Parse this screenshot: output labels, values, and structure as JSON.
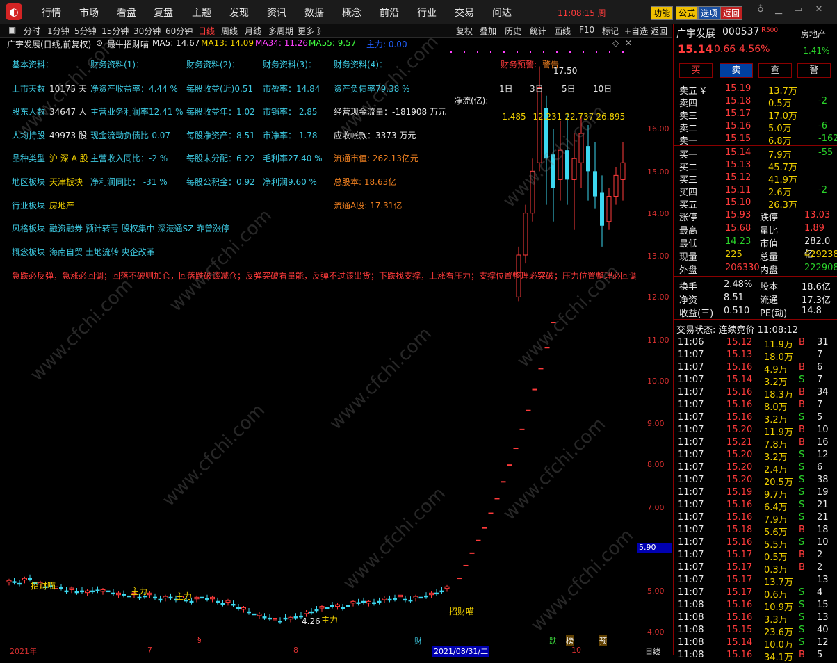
{
  "menu": [
    "行情",
    "市场",
    "看盘",
    "复盘",
    "主题",
    "发现",
    "资讯",
    "数据",
    "概念",
    "前沿",
    "行业",
    "交易",
    "问达"
  ],
  "clock": "11:08:15 周一",
  "top_buttons": [
    "功能",
    "公式",
    "选项",
    "返回"
  ],
  "periods": [
    "分时",
    "1分钟",
    "5分钟",
    "15分钟",
    "30分钟",
    "60分钟",
    "日线",
    "周线",
    "月线",
    "多周期",
    "更多 》"
  ],
  "tools": [
    "复权",
    "叠加",
    "历史",
    "统计",
    "画线",
    "F10",
    "标记",
    "+自选",
    "返回"
  ],
  "chart_title": "广宇发展(日线,前复权)",
  "indicator_name": "最牛招财喵",
  "ma": {
    "ma5": "MA5: 14.67",
    "ma13": "MA13: 14.09",
    "ma34": "MA34: 11.26",
    "ma55": "MA55: 9.57",
    "main": "主力: 0.00"
  },
  "fund_headers": [
    "基本资料：",
    "财务资料(1)：",
    "财务资料(2)：",
    "财务资料(3)：",
    "财务资料(4)：",
    "财务预警:",
    "警告"
  ],
  "fund": {
    "r1": [
      "上市天数",
      "10175 天",
      "净资产收益率：4.44 %",
      "每股收益(近)0.51",
      "市盈率：14.84",
      "资产负债率79.38 %"
    ],
    "r2": [
      "股东人数",
      "34647 人",
      "主营业务利润率12.41 %",
      "每股收益年：1.02",
      "市销率： 2.85",
      "经营现金流量：-181908 万元"
    ],
    "r3": [
      "人均持股",
      "49973 股",
      "现金流动负债比-0.07",
      "每股净资产：8.51",
      "市净率： 1.78",
      "应收帐款：3373 万元"
    ],
    "r4": [
      "品种类型",
      "沪 深 A 股",
      "主营收入同比：-2 %",
      "每股未分配：6.22",
      "毛利率27.40 %",
      "流通市值: 262.13亿元"
    ],
    "r5": [
      "地区板块",
      "天津板块",
      "净利润同比： -31 %",
      "每股公积金：0.92",
      "净利润9.60 %",
      "总股本: 18.63亿"
    ],
    "r6": [
      "行业板块",
      "房地产",
      "流通A股: 17.31亿"
    ],
    "r7": [
      "风格板块",
      "融资融券 预计转亏 股权集中 深港通SZ 昨曾涨停"
    ],
    "r8": [
      "概念板块",
      "海南自贸 土地流转 央企改革"
    ],
    "warning": "急跌必反弹，急涨必回调；回落不破则加仓，回落跌破该减仓；反弹突破看量能，反弹不过该出货；下跌找支撑，上涨看压力；支撑位置整理必突破；压力位置整理必回调"
  },
  "netflow": {
    "label": "净流(亿):",
    "days": [
      "1日",
      "3日",
      "5日",
      "10日"
    ],
    "values": [
      "-1.485",
      "-12.231",
      "-22.737",
      "-26.895"
    ]
  },
  "annotations": {
    "high": "17.50",
    "low": "4.26",
    "zhaocaimiao": "招财喵",
    "zhuli": "主力"
  },
  "yaxis_ticks": [
    "16.00",
    "15.00",
    "14.00",
    "13.00",
    "12.00",
    "11.00",
    "10.00",
    "9.00",
    "8.00",
    "7.00",
    "6.00",
    "5.00",
    "4.00"
  ],
  "price_box": "5.90",
  "xaxis": [
    "2021年",
    "7",
    "8",
    "2021/08/31/二",
    "10",
    "日线"
  ],
  "bottom_marks": [
    "财",
    "跌",
    "榜",
    "预"
  ],
  "right": {
    "name": "广宇发展",
    "code": "000537",
    "sector": "房地产",
    "price": "15.14",
    "change": "0.66",
    "pct": "4.56%",
    "sector_pct": "-1.41%",
    "buttons": [
      "买",
      "卖",
      "查",
      "警"
    ],
    "asks": [
      {
        "label": "卖五 ¥",
        "price": "15.19",
        "vol": "13.7万",
        "chg": ""
      },
      {
        "label": "卖四",
        "price": "15.18",
        "vol": "0.5万",
        "chg": "-2"
      },
      {
        "label": "卖三",
        "price": "15.17",
        "vol": "17.0万",
        "chg": ""
      },
      {
        "label": "卖二",
        "price": "15.16",
        "vol": "5.0万",
        "chg": "-6"
      },
      {
        "label": "卖一",
        "price": "15.15",
        "vol": "6.8万",
        "chg": "-162"
      }
    ],
    "bids": [
      {
        "label": "买一",
        "price": "15.14",
        "vol": "7.9万",
        "chg": "-55"
      },
      {
        "label": "买二",
        "price": "15.13",
        "vol": "45.7万",
        "chg": ""
      },
      {
        "label": "买三",
        "price": "15.12",
        "vol": "41.9万",
        "chg": ""
      },
      {
        "label": "买四",
        "price": "15.11",
        "vol": "2.6万",
        "chg": "-2"
      },
      {
        "label": "买五",
        "price": "15.10",
        "vol": "26.3万",
        "chg": ""
      }
    ],
    "stats": [
      [
        "涨停",
        "15.93",
        "跌停",
        "13.03"
      ],
      [
        "最高",
        "15.68",
        "量比",
        "1.89"
      ],
      [
        "最低",
        "14.23",
        "市值",
        "282.0亿"
      ],
      [
        "现量",
        "225",
        "总量",
        "429238"
      ],
      [
        "外盘",
        "206330",
        "内盘",
        "222908"
      ]
    ],
    "stats2": [
      [
        "换手",
        "2.48%",
        "股本",
        "18.6亿"
      ],
      [
        "净资",
        "8.51",
        "流通",
        "17.3亿"
      ],
      [
        "收益(三)",
        "0.510",
        "PE(动)",
        "14.8"
      ]
    ],
    "trade_status": "交易状态: 连续竞价 11:08:12",
    "ticks": [
      [
        "11:06",
        "15.12",
        "11.9万",
        "B",
        "31"
      ],
      [
        "11:07",
        "15.13",
        "18.0万",
        "",
        "7"
      ],
      [
        "11:07",
        "15.16",
        "4.9万",
        "B",
        "6"
      ],
      [
        "11:07",
        "15.14",
        "3.2万",
        "S",
        "7"
      ],
      [
        "11:07",
        "15.16",
        "18.3万",
        "B",
        "34"
      ],
      [
        "11:07",
        "15.16",
        "8.0万",
        "B",
        "7"
      ],
      [
        "11:07",
        "15.16",
        "3.2万",
        "S",
        "5"
      ],
      [
        "11:07",
        "15.20",
        "11.9万",
        "B",
        "10"
      ],
      [
        "11:07",
        "15.21",
        "7.8万",
        "B",
        "16"
      ],
      [
        "11:07",
        "15.20",
        "3.2万",
        "S",
        "12"
      ],
      [
        "11:07",
        "15.20",
        "2.4万",
        "S",
        "6"
      ],
      [
        "11:07",
        "15.20",
        "20.5万",
        "S",
        "38"
      ],
      [
        "11:07",
        "15.19",
        "9.7万",
        "S",
        "19"
      ],
      [
        "11:07",
        "15.16",
        "6.4万",
        "S",
        "21"
      ],
      [
        "11:07",
        "15.16",
        "7.9万",
        "S",
        "21"
      ],
      [
        "11:07",
        "15.18",
        "5.6万",
        "B",
        "18"
      ],
      [
        "11:07",
        "15.16",
        "5.5万",
        "S",
        "10"
      ],
      [
        "11:07",
        "15.17",
        "0.5万",
        "B",
        "2"
      ],
      [
        "11:07",
        "15.17",
        "0.3万",
        "B",
        "2"
      ],
      [
        "11:07",
        "15.17",
        "13.7万",
        "",
        "13"
      ],
      [
        "11:07",
        "15.17",
        "0.6万",
        "S",
        "4"
      ],
      [
        "11:08",
        "15.16",
        "10.9万",
        "S",
        "15"
      ],
      [
        "11:08",
        "15.16",
        "3.3万",
        "S",
        "13"
      ],
      [
        "11:08",
        "15.15",
        "23.6万",
        "S",
        "40"
      ],
      [
        "11:08",
        "15.14",
        "10.0万",
        "S",
        "12"
      ],
      [
        "11:08",
        "15.16",
        "34.1万",
        "B",
        "5"
      ]
    ]
  },
  "watermark": "www.cfchi.com",
  "colors": {
    "up": "#ff3b3b",
    "down": "#3cd8f0",
    "ma5": "#ffffff",
    "ma13": "#f0d000",
    "ma34": "#ff40ff",
    "ma55": "#40ff40"
  }
}
